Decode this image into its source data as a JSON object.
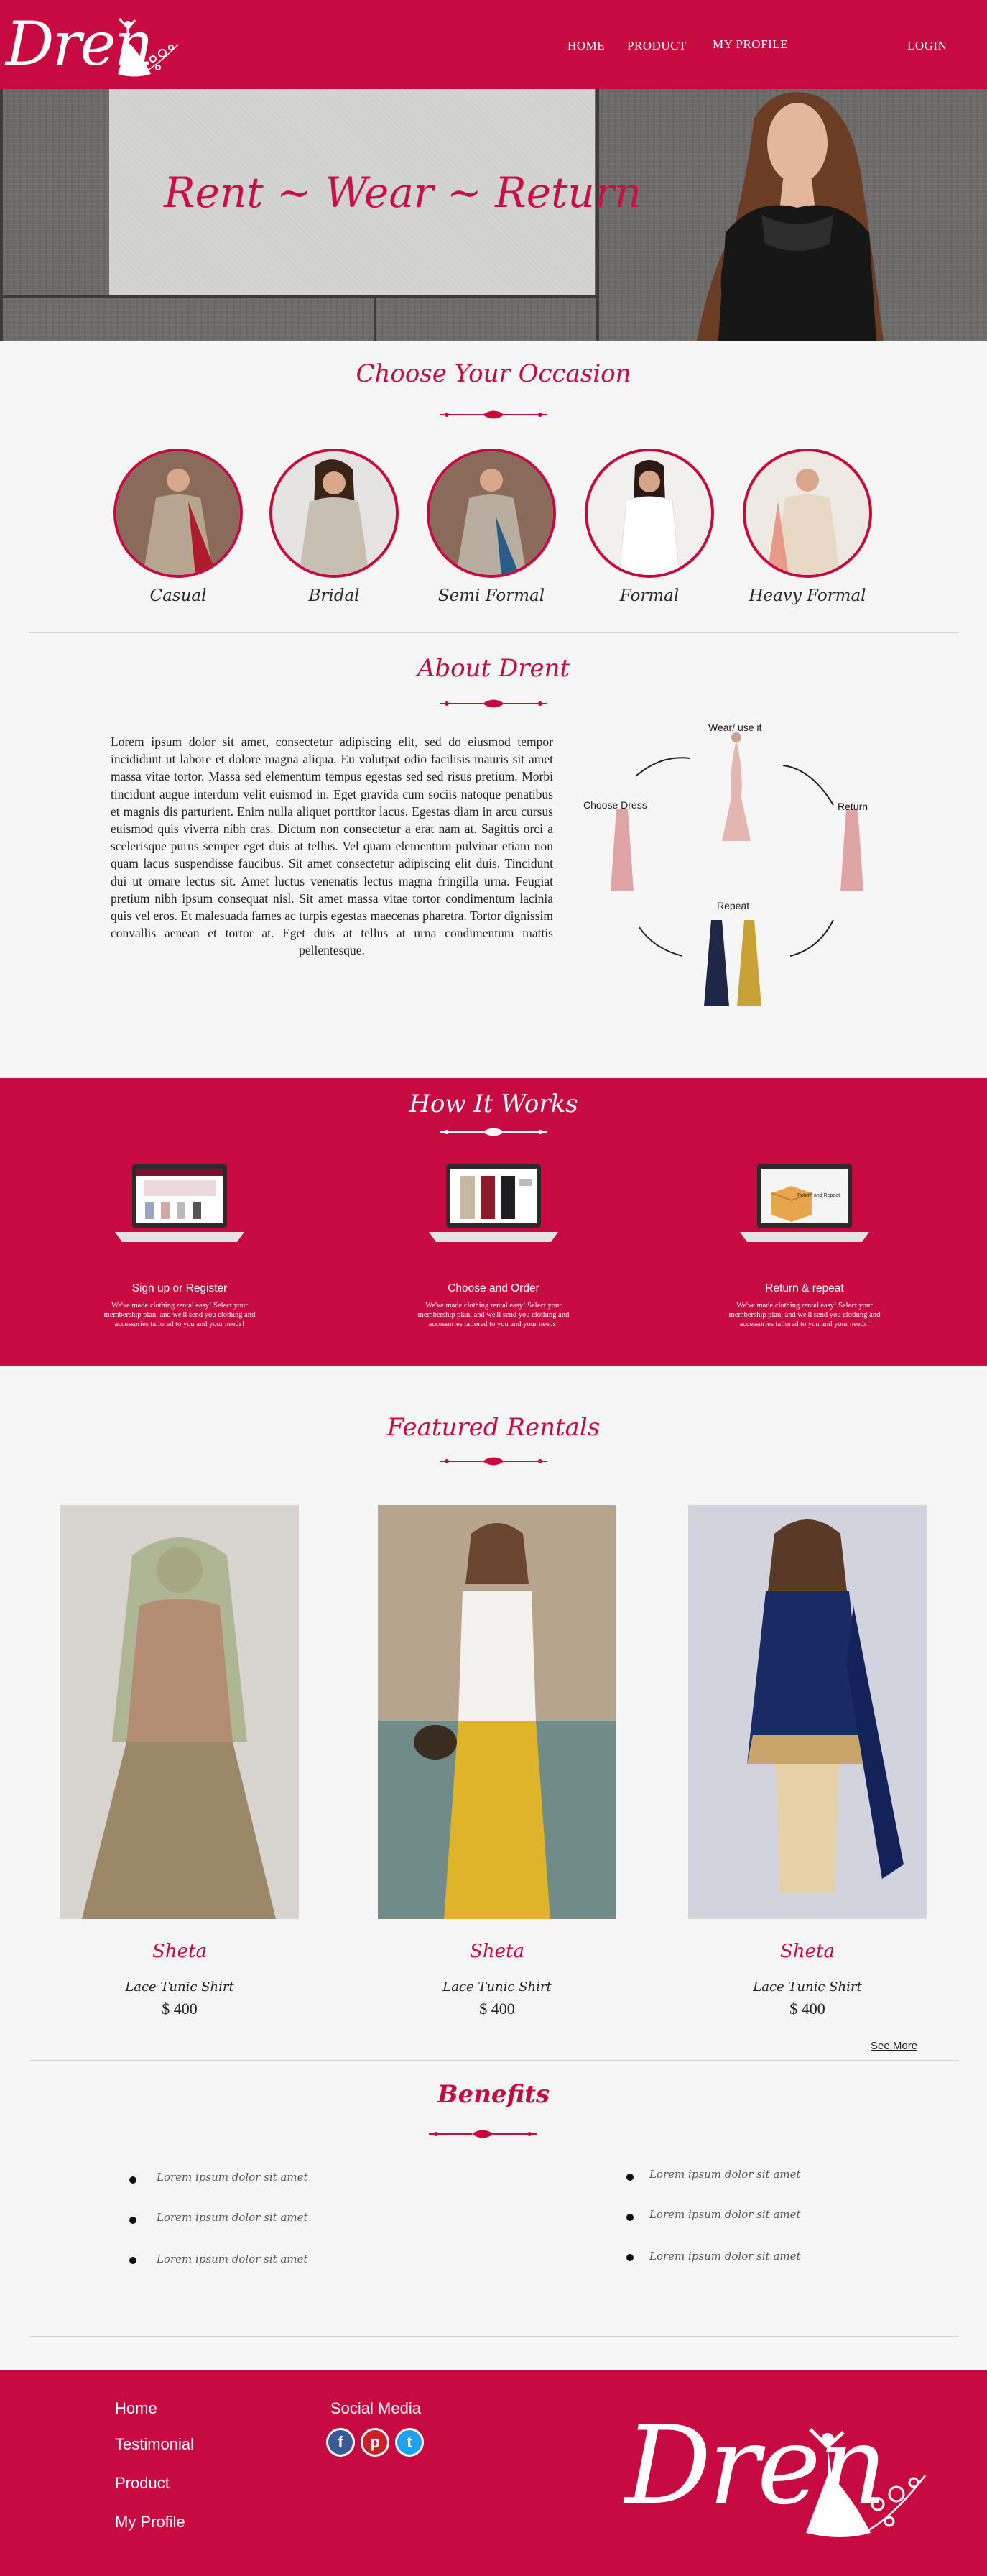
{
  "brand": {
    "logo_text": "Dren"
  },
  "nav": {
    "home": "HOME",
    "product": "PRODUCT",
    "profile": "MY PROFILE",
    "login": "LOGIN"
  },
  "hero": {
    "slogan": "Rent ~ Wear ~ Return"
  },
  "occasions": {
    "title": "Choose Your Occasion",
    "items": [
      {
        "label": "Casual"
      },
      {
        "label": "Bridal"
      },
      {
        "label": "Semi Formal"
      },
      {
        "label": "Formal"
      },
      {
        "label": "Heavy Formal"
      }
    ]
  },
  "about": {
    "title": "About Drent",
    "body": "Lorem ipsum dolor sit amet, consectetur adipiscing elit, sed do eiusmod tempor incididunt ut labore et dolore magna aliqua. Eu volutpat odio facilisis mauris sit amet massa vitae tortor. Massa sed elementum tempus egestas sed sed risus pretium. Morbi tincidunt augue interdum velit euismod in. Eget gravida cum sociis natoque penatibus et magnis dis parturient. Enim nulla aliquet porttitor lacus. Egestas diam in arcu cursus euismod quis viverra nibh cras. Dictum non consectetur a erat nam at. Sagittis orci a scelerisque purus semper eget duis at tellus. Vel quam elementum pulvinar etiam non quam lacus suspendisse faucibus. Sit amet consectetur adipiscing elit duis. Tincidunt dui ut ornare lectus sit. Amet luctus venenatis lectus magna fringilla urna. Feugiat pretium nibh ipsum consequat nisl. Sit amet massa vitae tortor condimentum lacinia quis vel eros. Et malesuada fames ac turpis egestas maecenas pharetra. Tortor dignissim convallis aenean et tortor at. Eget duis at tellus at urna condimentum mattis pellentesque.",
    "cycle": {
      "wear": "Wear/ use it",
      "choose": "Choose Dress",
      "return": "Return",
      "repeat": "Repeat"
    }
  },
  "how": {
    "title": "How It Works",
    "steps": [
      {
        "title": "Sign up or Register",
        "desc": "We've made clothing rental easy! Select your membership plan, and we'll send you clothing and accessories tailored to you and your needs!"
      },
      {
        "title": "Choose and Order",
        "desc": "We've made clothing rental easy! Select your membership plan, and we'll send you clothing and accessories tailored to you and your needs!"
      },
      {
        "title": "Return & repeat",
        "desc": "We've made clothing rental easy! Select your membership plan, and we'll send you clothing and accessories tailored to you and your needs!",
        "screen_label": "Return and Repeat"
      }
    ]
  },
  "featured": {
    "title": "Featured Rentals",
    "items": [
      {
        "name": "Sheta",
        "sub": "Lace Tunic Shirt",
        "price": "$  400"
      },
      {
        "name": "Sheta",
        "sub": "Lace Tunic Shirt",
        "price": "$  400"
      },
      {
        "name": "Sheta",
        "sub": "Lace Tunic Shirt",
        "price": "$  400"
      }
    ],
    "see_more": "See More"
  },
  "benefits": {
    "title": "Benefits",
    "left": [
      "Lorem ipsum dolor sit amet",
      "Lorem ipsum dolor sit amet",
      "Lorem ipsum dolor sit amet"
    ],
    "right": [
      "Lorem ipsum dolor sit amet",
      "Lorem ipsum dolor sit amet",
      "Lorem ipsum dolor sit amet"
    ]
  },
  "footer": {
    "links": [
      "Home",
      "Testimonial",
      "Product",
      "My Profile"
    ],
    "social_title": "Social Media",
    "social": [
      {
        "icon": "facebook-icon",
        "glyph": "f",
        "color": "#3b5998"
      },
      {
        "icon": "pinterest-icon",
        "glyph": "p",
        "color": "#cb2027"
      },
      {
        "icon": "twitter-icon",
        "glyph": "t",
        "color": "#1da1f2"
      }
    ]
  },
  "colors": {
    "brand": "#c70a3f",
    "background": "#f7f6f7"
  }
}
